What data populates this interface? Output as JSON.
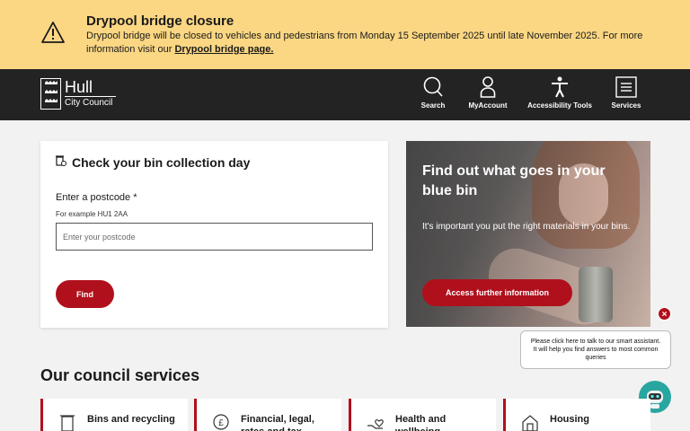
{
  "alert": {
    "title": "Drypool bridge closure",
    "body": "Drypool bridge will be closed to vehicles and pedestrians from Monday 15 September 2025 until late November 2025. For more information visit our ",
    "link": "Drypool bridge page."
  },
  "header": {
    "logo_line1": "Hull",
    "logo_line2": "City Council",
    "nav": [
      {
        "label": "Search",
        "icon": "search-icon"
      },
      {
        "label": "MyAccount",
        "icon": "account-icon"
      },
      {
        "label": "Accessibility Tools",
        "icon": "accessibility-icon"
      },
      {
        "label": "Services",
        "icon": "menu-icon"
      }
    ]
  },
  "bin": {
    "title": "Check your bin collection day",
    "postcode_label": "Enter a postcode *",
    "postcode_hint": "For example HU1 2AA",
    "postcode_placeholder": "Enter your postcode",
    "postcode_value": "",
    "find_label": "Find"
  },
  "promo": {
    "title": "Find out what goes in your blue bin",
    "text": "It's important you put the right materials in your bins.",
    "button": "Access further information"
  },
  "chat": {
    "close": "×",
    "bubble": "Please click here to talk to our smart assistant. It will help you find answers to most common queries"
  },
  "services": {
    "heading": "Our council services",
    "items": [
      {
        "label": "Bins and recycling",
        "icon": "bin-icon"
      },
      {
        "label": "Financial, legal, rates and tax",
        "icon": "money-icon"
      },
      {
        "label": "Health and wellbeing",
        "icon": "health-icon"
      },
      {
        "label": "Housing",
        "icon": "house-icon"
      }
    ]
  },
  "colors": {
    "alert_bg": "#fbd783",
    "header_bg": "#232323",
    "accent": "#b0101c",
    "page_bg": "#f2f2f2",
    "chat_avatar": "#2aa6a0"
  }
}
